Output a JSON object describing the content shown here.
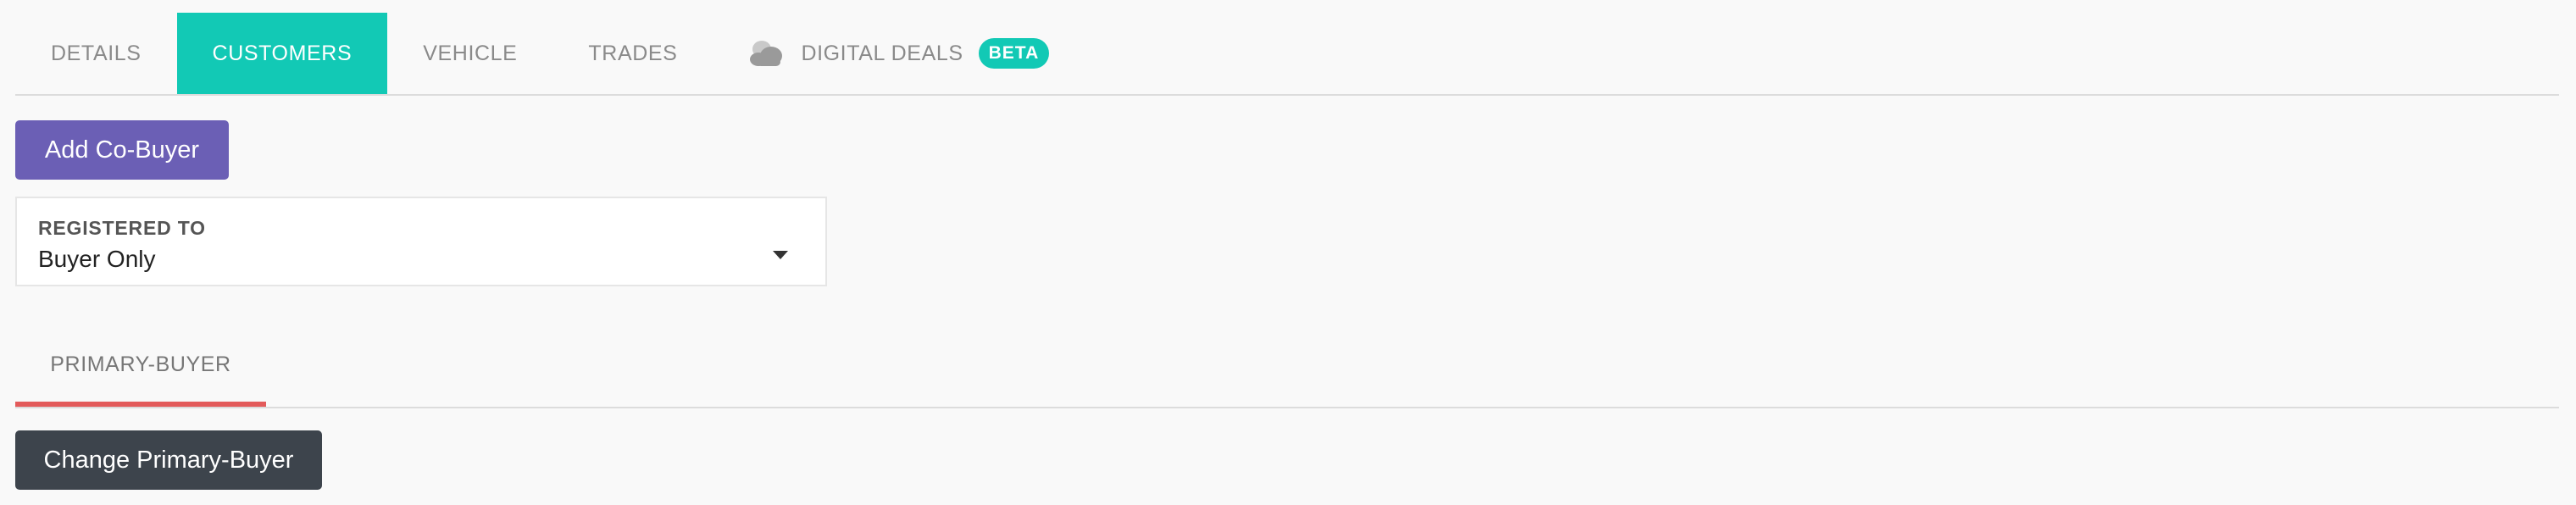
{
  "tabs": [
    {
      "label": "DETAILS",
      "active": false
    },
    {
      "label": "CUSTOMERS",
      "active": true
    },
    {
      "label": "VEHICLE",
      "active": false
    },
    {
      "label": "TRADES",
      "active": false
    },
    {
      "label": "DIGITAL DEALS",
      "active": false,
      "icon": "cloud-icon",
      "badge": "BETA"
    }
  ],
  "add_co_buyer_label": "Add Co-Buyer",
  "registered_to": {
    "label": "REGISTERED TO",
    "value": "Buyer Only"
  },
  "subtabs": [
    {
      "label": "PRIMARY-BUYER",
      "active": true
    }
  ],
  "change_primary_buyer_label": "Change Primary-Buyer",
  "colors": {
    "accent_teal": "#12c9b5",
    "button_purple": "#6b5fb5",
    "button_dark": "#3d444c",
    "active_underline": "#e35b5b"
  }
}
